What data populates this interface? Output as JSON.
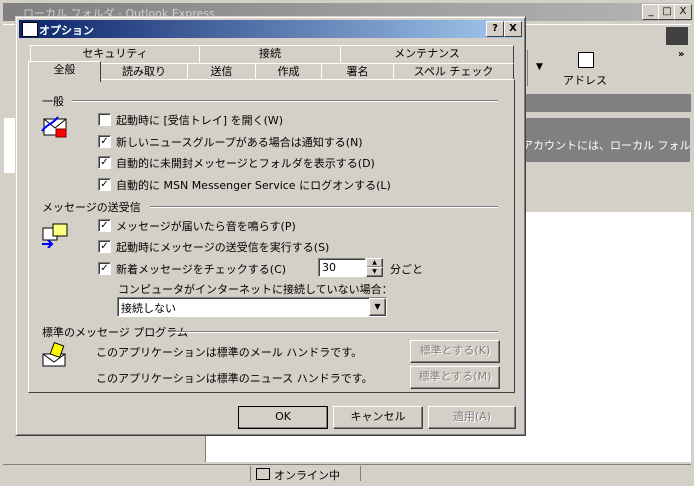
{
  "background_window": {
    "title": "ローカル フォルダ - Outlook Express",
    "toolbar_address_label": "アドレス",
    "right_panel_text": "アカウントには、ローカル フォル",
    "status_text": "オンライン中",
    "min_glyph": "_",
    "max_glyph": "□",
    "close_glyph": "X"
  },
  "dialog": {
    "title": "オプション",
    "help_glyph": "?",
    "close_glyph": "X",
    "tabs_back": [
      "セキュリティ",
      "接続",
      "メンテナンス"
    ],
    "tabs_front": [
      "全般",
      "読み取り",
      "送信",
      "作成",
      "署名",
      "スペル チェック"
    ],
    "selected_tab": "全般",
    "sections": {
      "general": {
        "label": "一般",
        "options": [
          {
            "label": "起動時に [受信トレイ] を開く(W)",
            "checked": false
          },
          {
            "label": "新しいニュースグループがある場合は通知する(N)",
            "checked": true
          },
          {
            "label": "自動的に未開封メッセージとフォルダを表示する(D)",
            "checked": true
          },
          {
            "label": "自動的に MSN Messenger Service にログオンする(L)",
            "checked": true
          }
        ]
      },
      "send_receive": {
        "label": "メッセージの送受信",
        "options": [
          {
            "label": "メッセージが届いたら音を鳴らす(P)",
            "checked": true
          },
          {
            "label": "起動時にメッセージの送受信を実行する(S)",
            "checked": true
          },
          {
            "label": "新着メッセージをチェックする(C)",
            "checked": true
          }
        ],
        "interval_value": "30",
        "interval_unit": "分ごと",
        "offline_prompt": "コンピュータがインターネットに接続していない場合：",
        "offline_select_value": "接続しない"
      },
      "default_programs": {
        "label": "標準のメッセージ プログラム",
        "mail_text": "このアプリケーションは標準のメール ハンドラです。",
        "mail_button": "標準とする(K)",
        "news_text": "このアプリケーションは標準のニュース ハンドラです。",
        "news_button": "標準とする(M)"
      }
    },
    "buttons": {
      "ok": "OK",
      "cancel": "キャンセル",
      "apply": "適用(A)"
    },
    "check_glyph": "✓",
    "spin_up_glyph": "▲",
    "spin_down_glyph": "▼",
    "dropdown_glyph": "▼"
  }
}
